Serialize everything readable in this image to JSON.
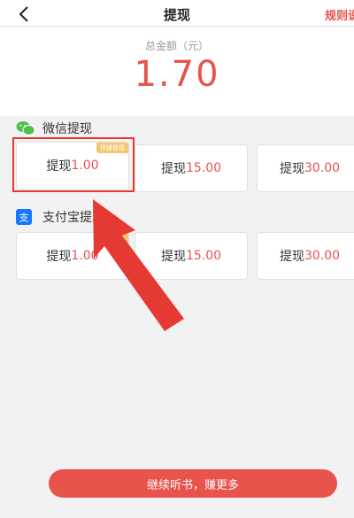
{
  "header": {
    "back_icon": "chevron-left-icon",
    "title": "提现",
    "rules_label": "规则说"
  },
  "summary": {
    "total_label": "总金额（元）",
    "total_amount": "1.70"
  },
  "wechat": {
    "icon": "wechat-icon",
    "title": "微信提现",
    "options": [
      {
        "prefix": "提现",
        "amount": "1.00",
        "badge": "快速提现"
      },
      {
        "prefix": "提现",
        "amount": "15.00"
      },
      {
        "prefix": "提现",
        "amount": "30.00"
      }
    ]
  },
  "alipay": {
    "icon": "alipay-icon",
    "title": "支付宝提现",
    "options": [
      {
        "prefix": "提现",
        "amount": "1.00",
        "badge": "快"
      },
      {
        "prefix": "提现",
        "amount": "15.00"
      },
      {
        "prefix": "提现",
        "amount": "30.00"
      }
    ]
  },
  "cta": {
    "label": "继续听书，赚更多"
  },
  "colors": {
    "accent": "#e8534c",
    "highlight": "#e43a33",
    "badge": "#f5c66e"
  }
}
